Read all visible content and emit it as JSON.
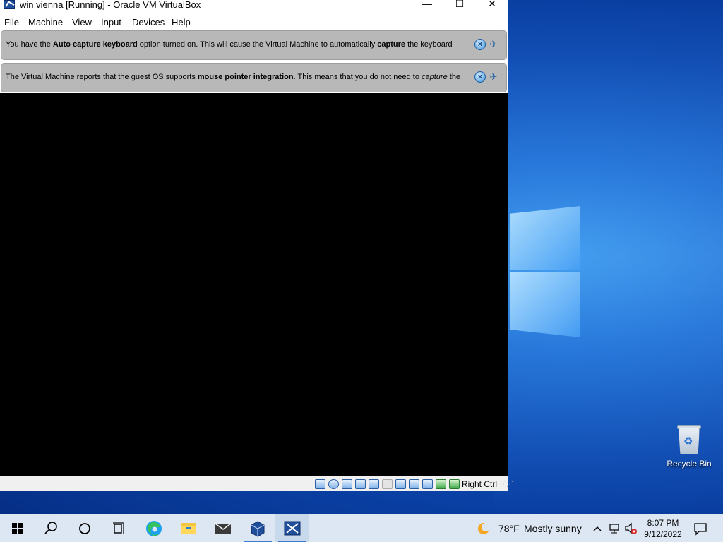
{
  "window": {
    "title": "win vienna [Running] - Oracle VM VirtualBox",
    "minimize_glyph": "—",
    "maximize_glyph": "☐",
    "close_glyph": "✕"
  },
  "menu": [
    "File",
    "Machine",
    "View",
    "Input",
    "Devices",
    "Help"
  ],
  "notices": [
    {
      "parts": [
        {
          "t": "You have the "
        },
        {
          "t": "Auto capture keyboard",
          "b": true
        },
        {
          "t": " option turned on. This will cause the Virtual Machine to automatically "
        },
        {
          "t": "capture",
          "b": true
        },
        {
          "t": " the keyboard"
        }
      ]
    },
    {
      "parts": [
        {
          "t": "The Virtual Machine reports that the guest OS supports "
        },
        {
          "t": "mouse pointer integration",
          "b": true
        },
        {
          "t": ". This means that you do not need to "
        },
        {
          "t": "capture",
          "i": true
        },
        {
          "t": " the"
        }
      ]
    }
  ],
  "statusbar": {
    "icons": [
      "hard-disk-icon",
      "optical-drive-icon",
      "audio-icon",
      "network-icon",
      "usb-icon",
      "shared-folders-icon",
      "display-icon",
      "video-capture-icon",
      "cpu-icon",
      "mouse-integration-icon",
      "keyboard-capture-icon"
    ],
    "host_key": "Right Ctrl"
  },
  "desktop": {
    "recycle_bin_label": "Recycle Bin"
  },
  "taskbar": {
    "apps": [
      "start-icon",
      "search-icon",
      "cortana-icon",
      "task-view-icon",
      "edge-icon",
      "file-explorer-icon",
      "mail-icon",
      "virtualbox-icon",
      "vm-window-icon"
    ],
    "weather_temp": "78°F",
    "weather_desc": "Mostly sunny",
    "time": "8:07 PM",
    "date": "9/12/2022"
  },
  "colors": {
    "desktop_blue": "#0b47b0",
    "taskbar_bg": "#dce7f3",
    "notice_bg": "#b8b8b8",
    "vm_screen": "#000000"
  }
}
